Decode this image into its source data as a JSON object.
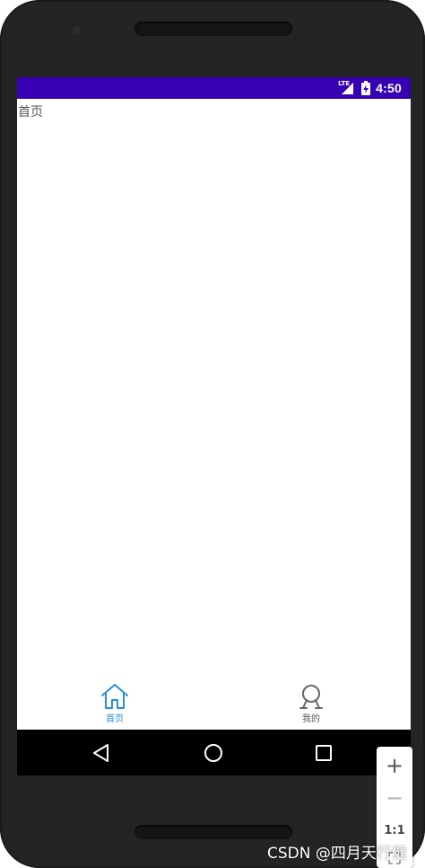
{
  "status_bar": {
    "network_label": "LTE",
    "time": "4:50",
    "background_color": "#3700b3"
  },
  "content": {
    "page_label": "首页"
  },
  "bottom_nav": {
    "items": [
      {
        "label": "首页",
        "icon": "home-icon",
        "selected": true,
        "color": "#2a8fd6"
      },
      {
        "label": "我的",
        "icon": "profile-icon",
        "selected": false,
        "color": "#555555"
      }
    ]
  },
  "system_nav": {
    "buttons": [
      "back-icon",
      "home-circle-icon",
      "recents-icon"
    ]
  },
  "zoom_controls": {
    "plus": "+",
    "minus": "−",
    "ratio": "1:1"
  },
  "watermark": "CSDN @四月天行健"
}
